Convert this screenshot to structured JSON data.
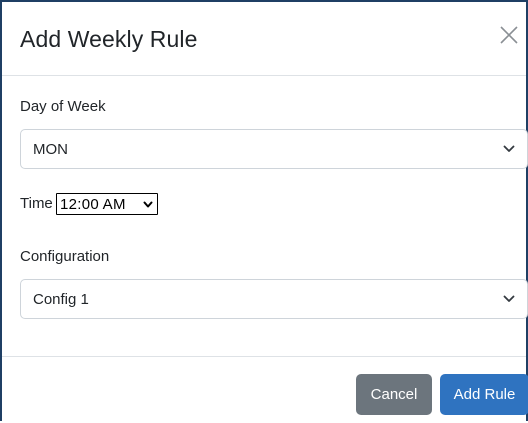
{
  "dialog": {
    "title": "Add Weekly Rule",
    "close_icon": "close-icon"
  },
  "form": {
    "day_of_week": {
      "label": "Day of Week",
      "selected": "MON"
    },
    "time": {
      "label": "Time",
      "selected": "12:00  AM"
    },
    "configuration": {
      "label": "Configuration",
      "selected": "Config 1"
    }
  },
  "footer": {
    "cancel_label": "Cancel",
    "add_label": "Add Rule"
  },
  "colors": {
    "cancel_button": "#6c757d",
    "primary_button": "#2f73c0",
    "frame": "#1f3f64"
  }
}
